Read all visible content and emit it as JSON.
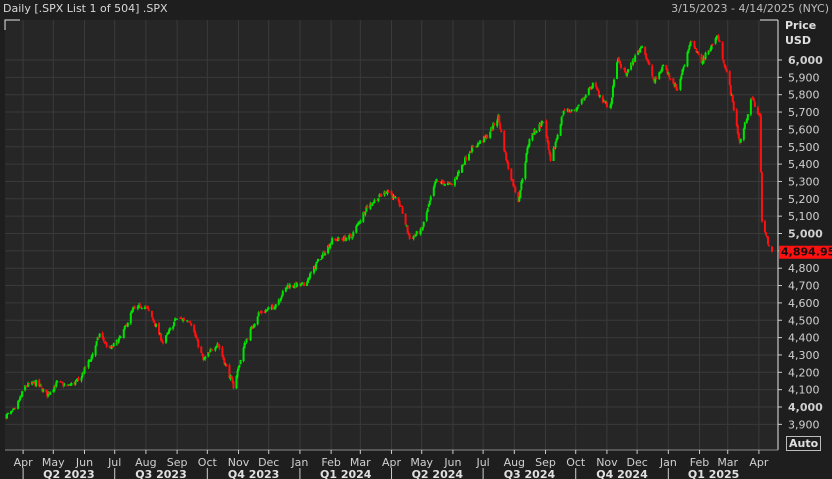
{
  "header": {
    "title": "Daily [.SPX List 1 of 504] .SPX",
    "date_range": "3/15/2023 - 4/14/2025 (NYC)"
  },
  "axis": {
    "price_label": "Price",
    "currency_label": "USD",
    "auto_button": "Auto"
  },
  "colors": {
    "up": "#00e600",
    "down": "#ff1010",
    "background": "#1e1e1e",
    "plot": "#262626",
    "grid": "#3a3a3a"
  },
  "chart_data": {
    "type": "candlestick",
    "title": "Daily [.SPX List 1 of 504] .SPX",
    "ylabel": "Price USD",
    "ylim": [
      3850,
      6200
    ],
    "yticks": [
      3900,
      4000,
      4100,
      4200,
      4300,
      4400,
      4500,
      4600,
      4700,
      4800,
      4900,
      5000,
      5100,
      5200,
      5300,
      5400,
      5500,
      5600,
      5700,
      5800,
      5900,
      6000
    ],
    "ytick_labels": [
      "3,900",
      "4,000",
      "4,100",
      "4,200",
      "4,300",
      "4,400",
      "4,500",
      "4,600",
      "4,700",
      "4,800",
      "",
      "5,000",
      "5,100",
      "5,200",
      "5,300",
      "5,400",
      "5,500",
      "5,600",
      "5,700",
      "5,800",
      "5,900",
      "6,000"
    ],
    "last_price": 4894.95,
    "last_price_label": "4,894.95",
    "start_date": "2023-03-15",
    "end_date": "2025-04-14",
    "months": [
      {
        "label": "Apr",
        "date": "2023-04-01"
      },
      {
        "label": "May",
        "date": "2023-05-01"
      },
      {
        "label": "Jun",
        "date": "2023-06-01"
      },
      {
        "label": "Jul",
        "date": "2023-07-01"
      },
      {
        "label": "Aug",
        "date": "2023-08-01"
      },
      {
        "label": "Sep",
        "date": "2023-09-01"
      },
      {
        "label": "Oct",
        "date": "2023-10-01"
      },
      {
        "label": "Nov",
        "date": "2023-11-01"
      },
      {
        "label": "Dec",
        "date": "2023-12-01"
      },
      {
        "label": "Jan",
        "date": "2024-01-01"
      },
      {
        "label": "Feb",
        "date": "2024-02-01"
      },
      {
        "label": "Mar",
        "date": "2024-03-01"
      },
      {
        "label": "Apr",
        "date": "2024-04-01"
      },
      {
        "label": "May",
        "date": "2024-05-01"
      },
      {
        "label": "Jun",
        "date": "2024-06-01"
      },
      {
        "label": "Jul",
        "date": "2024-07-01"
      },
      {
        "label": "Aug",
        "date": "2024-08-01"
      },
      {
        "label": "Sep",
        "date": "2024-09-01"
      },
      {
        "label": "Oct",
        "date": "2024-10-01"
      },
      {
        "label": "Nov",
        "date": "2024-11-01"
      },
      {
        "label": "Dec",
        "date": "2024-12-01"
      },
      {
        "label": "Jan",
        "date": "2025-01-01"
      },
      {
        "label": "Feb",
        "date": "2025-02-01"
      },
      {
        "label": "Mar",
        "date": "2025-03-01"
      },
      {
        "label": "Apr",
        "date": "2025-04-01"
      }
    ],
    "quarters": [
      {
        "label": "Q2 2023",
        "start": "2023-04-01",
        "end": "2023-07-01"
      },
      {
        "label": "Q3 2023",
        "start": "2023-07-01",
        "end": "2023-10-01"
      },
      {
        "label": "Q4 2023",
        "start": "2023-10-01",
        "end": "2024-01-01"
      },
      {
        "label": "Q1 2024",
        "start": "2024-01-01",
        "end": "2024-04-01"
      },
      {
        "label": "Q2 2024",
        "start": "2024-04-01",
        "end": "2024-07-01"
      },
      {
        "label": "Q3 2024",
        "start": "2024-07-01",
        "end": "2024-10-01"
      },
      {
        "label": "Q4 2024",
        "start": "2024-10-01",
        "end": "2025-01-01"
      },
      {
        "label": "Q1 2025",
        "start": "2025-01-01",
        "end": "2025-04-01"
      }
    ],
    "approx_closes": [
      [
        "2023-03-15",
        3950
      ],
      [
        "2023-03-24",
        3980
      ],
      [
        "2023-04-03",
        4120
      ],
      [
        "2023-04-14",
        4140
      ],
      [
        "2023-04-25",
        4070
      ],
      [
        "2023-05-05",
        4140
      ],
      [
        "2023-05-15",
        4120
      ],
      [
        "2023-05-26",
        4150
      ],
      [
        "2023-06-08",
        4290
      ],
      [
        "2023-06-16",
        4420
      ],
      [
        "2023-06-26",
        4330
      ],
      [
        "2023-07-07",
        4400
      ],
      [
        "2023-07-19",
        4560
      ],
      [
        "2023-07-31",
        4590
      ],
      [
        "2023-08-10",
        4480
      ],
      [
        "2023-08-18",
        4370
      ],
      [
        "2023-08-31",
        4510
      ],
      [
        "2023-09-14",
        4500
      ],
      [
        "2023-09-27",
        4270
      ],
      [
        "2023-10-11",
        4370
      ],
      [
        "2023-10-27",
        4120
      ],
      [
        "2023-11-08",
        4380
      ],
      [
        "2023-11-21",
        4540
      ],
      [
        "2023-12-05",
        4570
      ],
      [
        "2023-12-20",
        4700
      ],
      [
        "2024-01-05",
        4700
      ],
      [
        "2024-01-19",
        4840
      ],
      [
        "2024-02-02",
        4960
      ],
      [
        "2024-02-21",
        4980
      ],
      [
        "2024-03-07",
        5150
      ],
      [
        "2024-03-28",
        5250
      ],
      [
        "2024-04-10",
        5160
      ],
      [
        "2024-04-19",
        4970
      ],
      [
        "2024-05-01",
        5020
      ],
      [
        "2024-05-15",
        5300
      ],
      [
        "2024-05-31",
        5280
      ],
      [
        "2024-06-18",
        5480
      ],
      [
        "2024-07-05",
        5560
      ],
      [
        "2024-07-16",
        5670
      ],
      [
        "2024-07-25",
        5400
      ],
      [
        "2024-08-05",
        5190
      ],
      [
        "2024-08-16",
        5550
      ],
      [
        "2024-08-30",
        5650
      ],
      [
        "2024-09-06",
        5410
      ],
      [
        "2024-09-19",
        5710
      ],
      [
        "2024-10-01",
        5710
      ],
      [
        "2024-10-18",
        5860
      ],
      [
        "2024-11-04",
        5710
      ],
      [
        "2024-11-11",
        6000
      ],
      [
        "2024-11-20",
        5920
      ],
      [
        "2024-12-06",
        6090
      ],
      [
        "2024-12-18",
        5870
      ],
      [
        "2024-12-27",
        5970
      ],
      [
        "2025-01-10",
        5830
      ],
      [
        "2025-01-23",
        6110
      ],
      [
        "2025-02-03",
        5990
      ],
      [
        "2025-02-19",
        6140
      ],
      [
        "2025-03-03",
        5850
      ],
      [
        "2025-03-13",
        5520
      ],
      [
        "2025-03-25",
        5780
      ],
      [
        "2025-04-02",
        5670
      ],
      [
        "2025-04-04",
        5070
      ],
      [
        "2025-04-08",
        4982
      ],
      [
        "2025-04-14",
        4894.95
      ]
    ]
  }
}
